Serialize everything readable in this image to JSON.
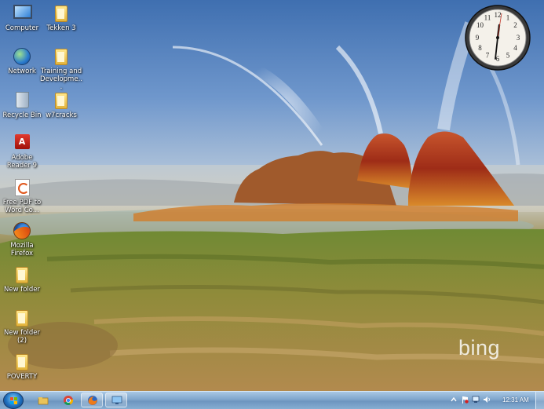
{
  "wallpaper": {
    "watermark": "bing"
  },
  "desktop": {
    "icons": [
      {
        "label": "Computer",
        "icon": "computer-icon"
      },
      {
        "label": "Tekken 3",
        "icon": "folder-icon"
      },
      {
        "label": "Network",
        "icon": "network-icon"
      },
      {
        "label": "Training and Developme...",
        "icon": "folder-icon"
      },
      {
        "label": "Recycle Bin",
        "icon": "recycle-bin-icon"
      },
      {
        "label": "w7cracks",
        "icon": "folder-icon"
      },
      {
        "label": "Adobe Reader 9",
        "icon": "adobe-reader-icon"
      },
      {
        "label": "Free PDF to Word Co...",
        "icon": "pdf-converter-icon"
      },
      {
        "label": "Mozilla Firefox",
        "icon": "firefox-icon"
      },
      {
        "label": "New folder",
        "icon": "folder-icon"
      },
      {
        "label": "New folder (2)",
        "icon": "folder-icon"
      },
      {
        "label": "POVERTY",
        "icon": "folder-icon"
      }
    ]
  },
  "gadget": {
    "clock_numbers": [
      "12",
      "1",
      "2",
      "3",
      "4",
      "5",
      "6",
      "7",
      "8",
      "9",
      "10",
      "11"
    ]
  },
  "taskbar": {
    "time": "12:31 AM",
    "pinned": [
      "explorer-icon",
      "chrome-icon",
      "firefox-icon",
      "network-window-icon"
    ],
    "accent": "#6d95bf"
  }
}
